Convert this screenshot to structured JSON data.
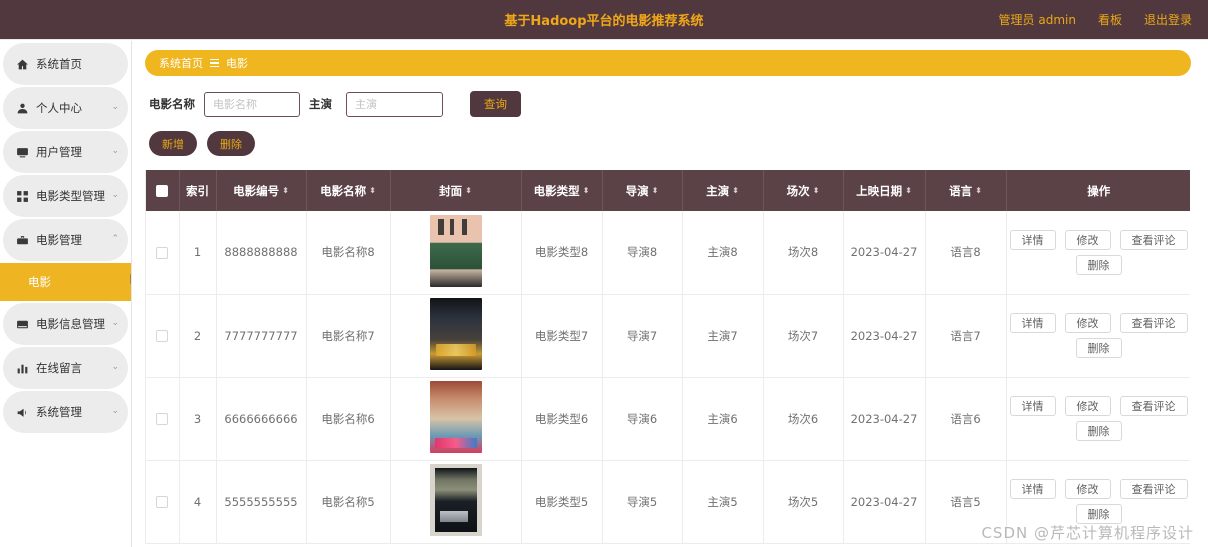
{
  "header": {
    "title": "基于Hadoop平台的电影推荐系统",
    "admin_label": "管理员 admin",
    "board_label": "看板",
    "logout_label": "退出登录"
  },
  "sidebar": {
    "items": [
      {
        "label": "系统首页",
        "icon": "home-icon",
        "arrow": "",
        "active": false
      },
      {
        "label": "个人中心",
        "icon": "user-icon",
        "arrow": "⌄",
        "active": false
      },
      {
        "label": "用户管理",
        "icon": "monitor-icon",
        "arrow": "⌄",
        "active": false
      },
      {
        "label": "电影类型管理",
        "icon": "grid-icon",
        "arrow": "⌄",
        "active": false
      },
      {
        "label": "电影管理",
        "icon": "briefcase-icon",
        "arrow": "⌃",
        "active": true
      },
      {
        "label": "电影信息管理",
        "icon": "card-icon",
        "arrow": "⌄",
        "active": false
      },
      {
        "label": "在线留言",
        "icon": "chart-icon",
        "arrow": "⌄",
        "active": false
      },
      {
        "label": "系统管理",
        "icon": "megaphone-icon",
        "arrow": "⌄",
        "active": false
      }
    ],
    "submenu": {
      "label": "电影"
    }
  },
  "breadcrumb": {
    "home": "系统首页",
    "current": "电影"
  },
  "search": {
    "movie_name_label": "电影名称",
    "movie_name_placeholder": "电影名称",
    "movie_name_value": "",
    "actor_label": "主演",
    "actor_placeholder": "主演",
    "actor_value": "",
    "query_label": "查询"
  },
  "toolbar": {
    "add_label": "新增",
    "delete_label": "删除"
  },
  "table": {
    "columns": [
      {
        "label": "",
        "name": "select-all",
        "sortable": false,
        "width": "33"
      },
      {
        "label": "索引",
        "name": "index",
        "sortable": false,
        "width": "37"
      },
      {
        "label": "电影编号",
        "name": "movie-id",
        "sortable": true,
        "width": "90"
      },
      {
        "label": "电影名称",
        "name": "movie-name",
        "sortable": true,
        "width": "84"
      },
      {
        "label": "封面",
        "name": "cover",
        "sortable": true,
        "width": "131"
      },
      {
        "label": "电影类型",
        "name": "movie-type",
        "sortable": true,
        "width": "81"
      },
      {
        "label": "导演",
        "name": "director",
        "sortable": true,
        "width": "80"
      },
      {
        "label": "主演",
        "name": "actor",
        "sortable": true,
        "width": "81"
      },
      {
        "label": "场次",
        "name": "session",
        "sortable": true,
        "width": "80"
      },
      {
        "label": "上映日期",
        "name": "release-date",
        "sortable": true,
        "width": "82"
      },
      {
        "label": "语言",
        "name": "language",
        "sortable": true,
        "width": "81"
      },
      {
        "label": "操作",
        "name": "operations",
        "sortable": false,
        "width": "185"
      }
    ],
    "rows": [
      {
        "index": "1",
        "movie_id": "8888888888",
        "movie_name": "电影名称8",
        "cover": "poster-8",
        "movie_type": "电影类型8",
        "director": "导演8",
        "actor": "主演8",
        "session": "场次8",
        "release_date": "2023-04-27",
        "language": "语言8"
      },
      {
        "index": "2",
        "movie_id": "7777777777",
        "movie_name": "电影名称7",
        "cover": "poster-7",
        "movie_type": "电影类型7",
        "director": "导演7",
        "actor": "主演7",
        "session": "场次7",
        "release_date": "2023-04-27",
        "language": "语言7"
      },
      {
        "index": "3",
        "movie_id": "6666666666",
        "movie_name": "电影名称6",
        "cover": "poster-6",
        "movie_type": "电影类型6",
        "director": "导演6",
        "actor": "主演6",
        "session": "场次6",
        "release_date": "2023-04-27",
        "language": "语言6"
      },
      {
        "index": "4",
        "movie_id": "5555555555",
        "movie_name": "电影名称5",
        "cover": "poster-5",
        "movie_type": "电影类型5",
        "director": "导演5",
        "actor": "主演5",
        "session": "场次5",
        "release_date": "2023-04-27",
        "language": "语言5"
      }
    ],
    "row_operations": {
      "detail": "详情",
      "edit": "修改",
      "comments": "查看评论",
      "delete": "删除"
    }
  },
  "watermark": {
    "text": "CSDN @芹芯计算机程序设计"
  },
  "colors": {
    "header_bg": "#51383e",
    "header_text": "#e8a817",
    "accent_yellow": "#efb620",
    "table_header_bg": "#5b4247",
    "button_dark": "#51383e"
  }
}
